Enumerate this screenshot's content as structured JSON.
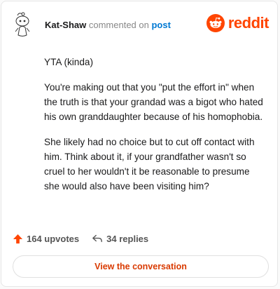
{
  "comment": {
    "author": "Kat-Shaw",
    "action_text": "commented on",
    "post_link": "post",
    "brand": "reddit",
    "paragraphs": [
      "YTA (kinda)",
      "You're making out that you \"put the effort in\" when the truth is that your grandad was a bigot who hated his own granddaughter because of his homophobia.",
      "She likely had no choice but to cut off contact with him. Think about it, if your grandfather wasn't so cruel to her wouldn't it be reasonable to presume she would also have been visiting him?"
    ],
    "upvotes": "164 upvotes",
    "replies": "34 replies",
    "cta": "View the conversation"
  },
  "colors": {
    "brand_orange": "#ff4500",
    "link_blue": "#0079d3",
    "cta_text": "#d93a00"
  },
  "icons": [
    "snoo-avatar-icon",
    "reddit-logo-icon",
    "upvote-arrow-icon",
    "reply-arrow-icon"
  ]
}
